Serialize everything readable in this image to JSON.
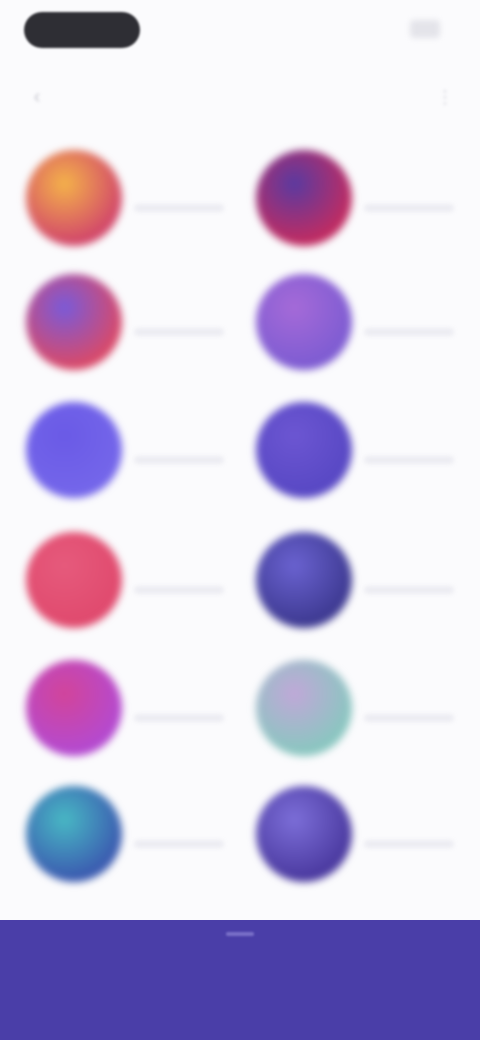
{
  "header": {
    "back_icon": "chevron-left-icon",
    "title": "",
    "more_icon": "ellipsis-icon"
  },
  "items": [
    {
      "name": "",
      "colors": [
        "#d2486a",
        "#f4b24a"
      ]
    },
    {
      "name": "",
      "colors": [
        "#c02c62",
        "#5a3aa0"
      ]
    },
    {
      "name": "",
      "colors": [
        "#d84a6a",
        "#7a5ad8"
      ]
    },
    {
      "name": "",
      "colors": [
        "#7e5cd2",
        "#a56ad8"
      ]
    },
    {
      "name": "",
      "colors": [
        "#7466ea",
        "#6a5ae6"
      ]
    },
    {
      "name": "",
      "colors": [
        "#5848c4",
        "#6c56d2"
      ]
    },
    {
      "name": "",
      "colors": [
        "#e04a6e",
        "#e65a7c"
      ]
    },
    {
      "name": "",
      "colors": [
        "#3e3a92",
        "#6a62d0"
      ]
    },
    {
      "name": "",
      "colors": [
        "#b44ad0",
        "#d2449a"
      ]
    },
    {
      "name": "",
      "colors": [
        "#8ac6c0",
        "#c0a8d8"
      ]
    },
    {
      "name": "",
      "colors": [
        "#3b5bb0",
        "#48b8c4"
      ]
    },
    {
      "name": "",
      "colors": [
        "#4b3aa0",
        "#7c6ed8"
      ]
    }
  ],
  "footer": {
    "label": ""
  },
  "theme": {
    "footer_bg": "#4a3ea8",
    "page_bg": "#fbfbfd"
  }
}
